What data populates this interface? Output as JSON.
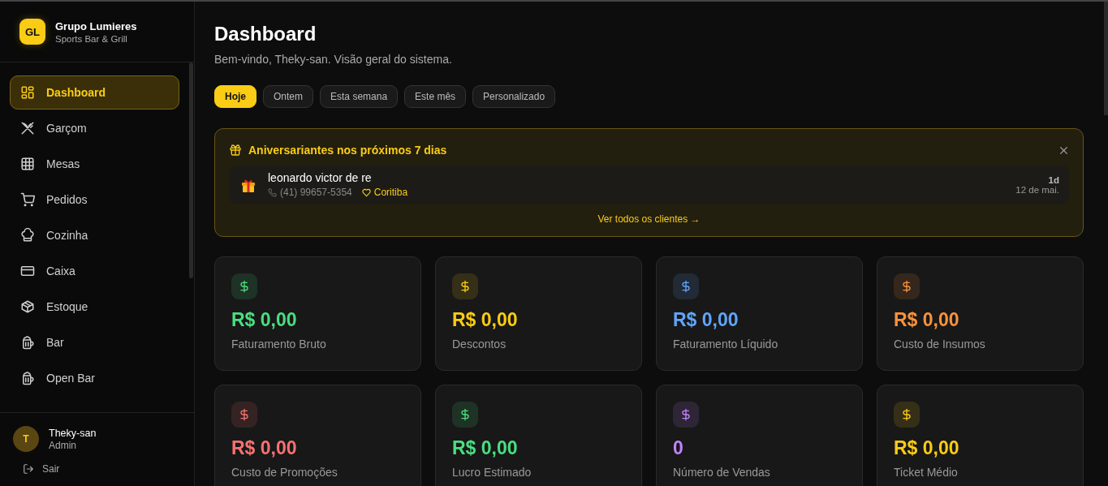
{
  "sidebar": {
    "logo": "GL",
    "brand": "Grupo Lumieres",
    "subtitle": "Sports Bar & Grill",
    "items": [
      {
        "label": "Dashboard",
        "selected": true
      },
      {
        "label": "Garçom",
        "selected": false
      },
      {
        "label": "Mesas",
        "selected": false
      },
      {
        "label": "Pedidos",
        "selected": false
      },
      {
        "label": "Cozinha",
        "selected": false
      },
      {
        "label": "Caixa",
        "selected": false
      },
      {
        "label": "Estoque",
        "selected": false
      },
      {
        "label": "Bar",
        "selected": false
      },
      {
        "label": "Open Bar",
        "selected": false
      }
    ],
    "user": {
      "initial": "T",
      "name": "Theky-san",
      "role": "Admin"
    },
    "logout": "Sair"
  },
  "header": {
    "title": "Dashboard",
    "subtitle": "Bem-vindo, Theky-san. Visão geral do sistema."
  },
  "filters": [
    {
      "label": "Hoje",
      "selected": true
    },
    {
      "label": "Ontem",
      "selected": false
    },
    {
      "label": "Esta semana",
      "selected": false
    },
    {
      "label": "Este mês",
      "selected": false
    },
    {
      "label": "Personalizado",
      "selected": false
    }
  ],
  "birthdays": {
    "title": "Aniversariantes nos próximos 7 dias",
    "people": [
      {
        "name": "leonardo victor de re",
        "phone": "(41) 99657-5354",
        "team": "Coritiba",
        "days": "1d",
        "date": "12 de mai."
      }
    ],
    "link": "Ver todos os clientes →"
  },
  "stats": [
    {
      "value": "R$ 0,00",
      "label": "Faturamento Bruto",
      "color": "#4ade80"
    },
    {
      "value": "R$ 0,00",
      "label": "Descontos",
      "color": "#facc15"
    },
    {
      "value": "R$ 0,00",
      "label": "Faturamento Líquido",
      "color": "#60a5fa"
    },
    {
      "value": "R$ 0,00",
      "label": "Custo de Insumos",
      "color": "#fb923c"
    },
    {
      "value": "R$ 0,00",
      "label": "Custo de Promoções",
      "color": "#f87171"
    },
    {
      "value": "R$ 0,00",
      "label": "Lucro Estimado",
      "color": "#4ade80"
    },
    {
      "value": "0",
      "label": "Número de Vendas",
      "color": "#c084fc"
    },
    {
      "value": "R$ 0,00",
      "label": "Ticket Médio",
      "color": "#facc15"
    }
  ]
}
